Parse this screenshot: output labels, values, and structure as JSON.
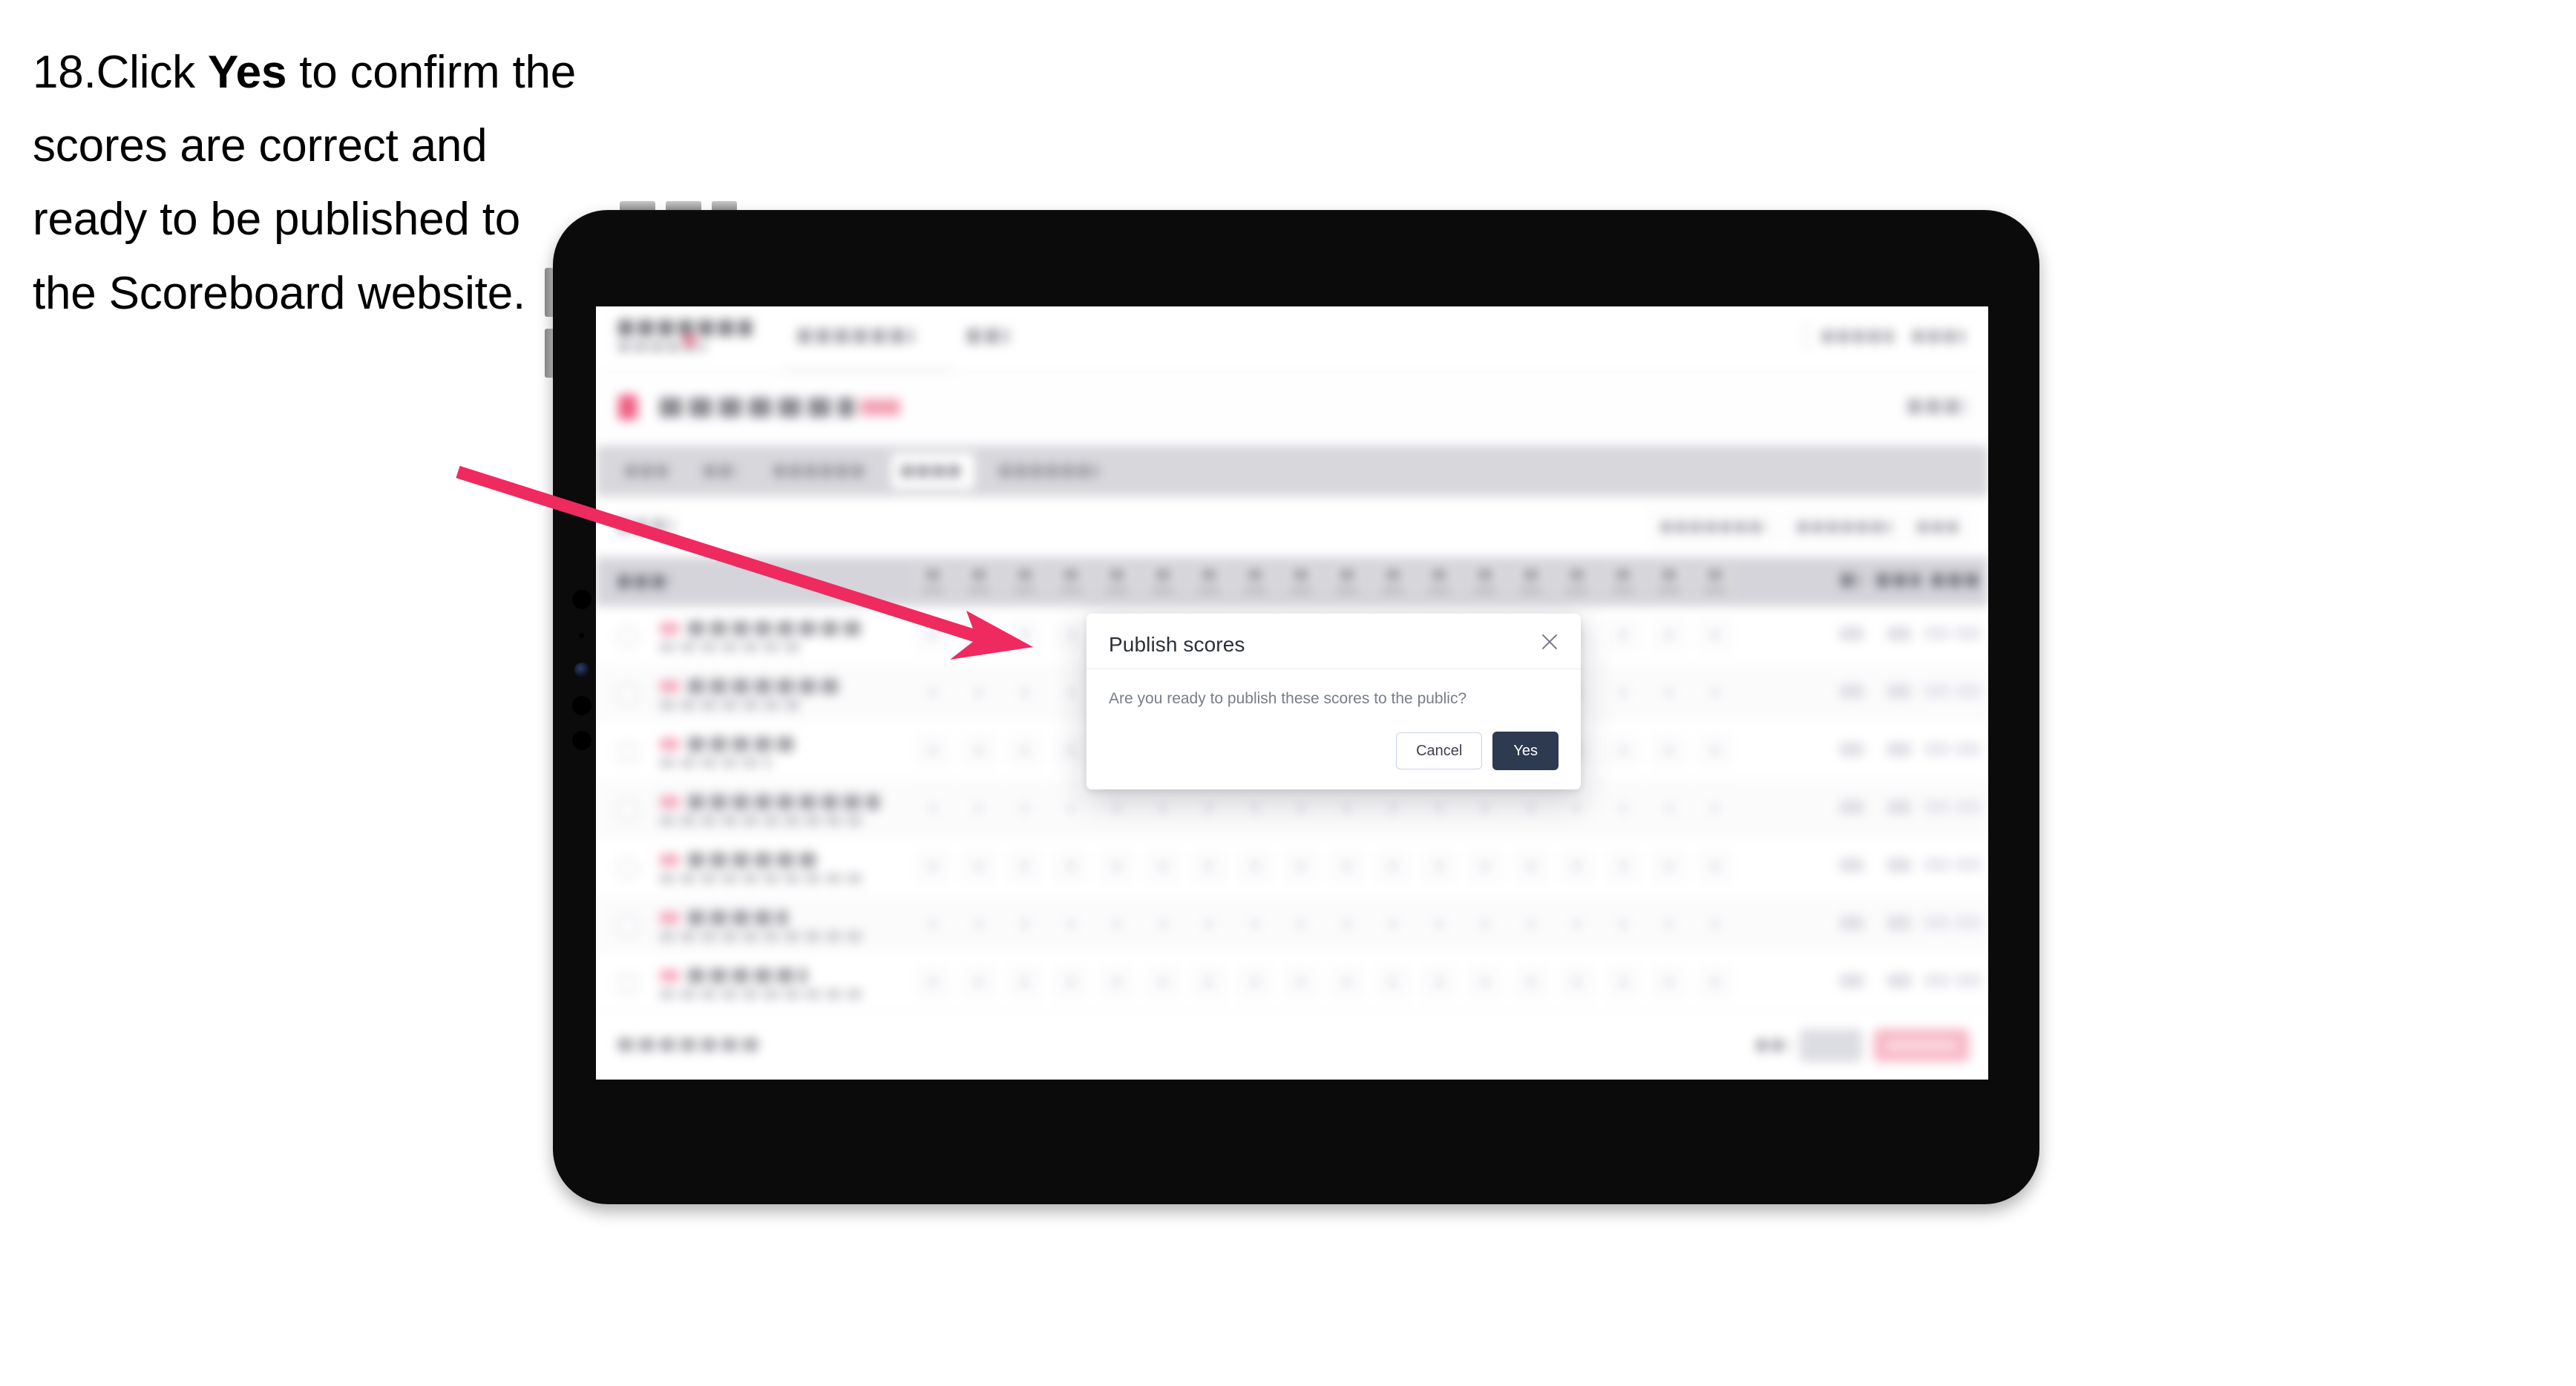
{
  "instruction": {
    "number": "18.",
    "prefix": "Click ",
    "bold_word": "Yes",
    "rest": " to confirm the scores are correct and ready to be published to the Scoreboard website."
  },
  "annotation": {
    "arrow_color": "#ee2a5f",
    "points_to": "publish-scores-dialog"
  },
  "device": {
    "type": "tablet",
    "frame_color": "#0b0b0b",
    "bezel_color": "#8e8e8e"
  },
  "dialog": {
    "title": "Publish scores",
    "body_text": "Are you ready to publish these scores to the public?",
    "close_icon": "close-icon",
    "cancel_label": "Cancel",
    "yes_label": "Yes",
    "yes_color": "#2d3a4f",
    "cancel_border_color": "#c8d4ea"
  },
  "app": {
    "blurred": true,
    "accent_color": "#ef5f84",
    "tab_strip_color": "#d7d7dc",
    "table_header_color": "#d4d4da",
    "active_tab_index": 3,
    "score_columns": 18,
    "rows": 7
  }
}
